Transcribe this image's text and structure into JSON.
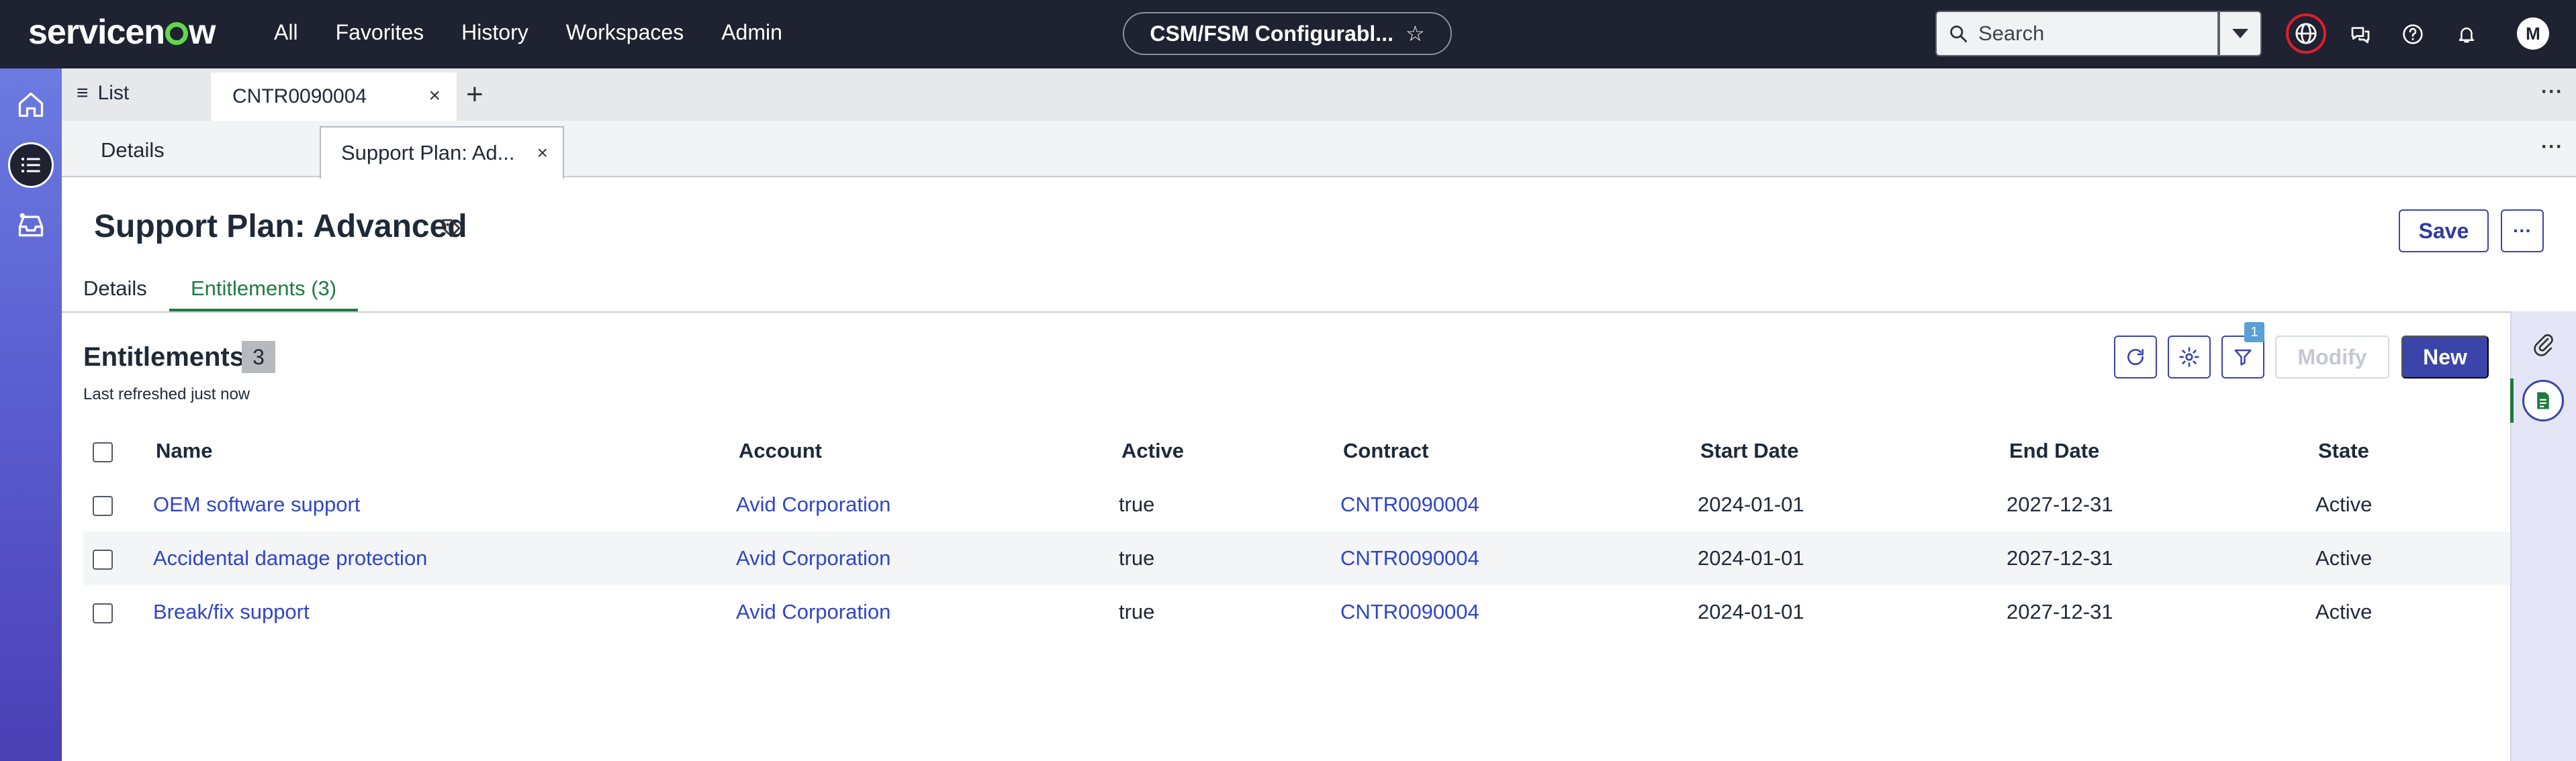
{
  "topnav": {
    "brand": "servicenow",
    "items": [
      "All",
      "Favorites",
      "History",
      "Workspaces",
      "Admin"
    ],
    "context_app": "CSM/FSM Configurabl...",
    "search_placeholder": "Search",
    "avatar_initial": "M"
  },
  "tabs": {
    "list_label": "List",
    "record_tab": "CNTR0090004"
  },
  "subtabs": {
    "details": "Details",
    "active": "Support Plan: Ad..."
  },
  "record": {
    "title": "Support Plan: Advanced",
    "save_label": "Save",
    "more_label": "···",
    "tabs": [
      "Details",
      "Entitlements (3)"
    ]
  },
  "related_list": {
    "title": "Entitlements",
    "count": "3",
    "refresh_status": "Last refreshed just now",
    "filter_count": "1",
    "modify_label": "Modify",
    "new_label": "New",
    "columns": [
      "Name",
      "Account",
      "Active",
      "Contract",
      "Start Date",
      "End Date",
      "State"
    ],
    "rows": [
      [
        "OEM software support",
        "Avid Corporation",
        "true",
        "CNTR0090004",
        "2024-01-01",
        "2027-12-31",
        "Active"
      ],
      [
        "Accidental damage protection",
        "Avid Corporation",
        "true",
        "CNTR0090004",
        "2024-01-01",
        "2027-12-31",
        "Active"
      ],
      [
        "Break/fix support",
        "Avid Corporation",
        "true",
        "CNTR0090004",
        "2024-01-01",
        "2027-12-31",
        "Active"
      ]
    ]
  },
  "colors": {
    "topbar": "#1f2230",
    "accent": "#3b44a8",
    "link": "#2f45c7",
    "active_tab": "#1e7a43",
    "logo_o": "#62d84e"
  }
}
